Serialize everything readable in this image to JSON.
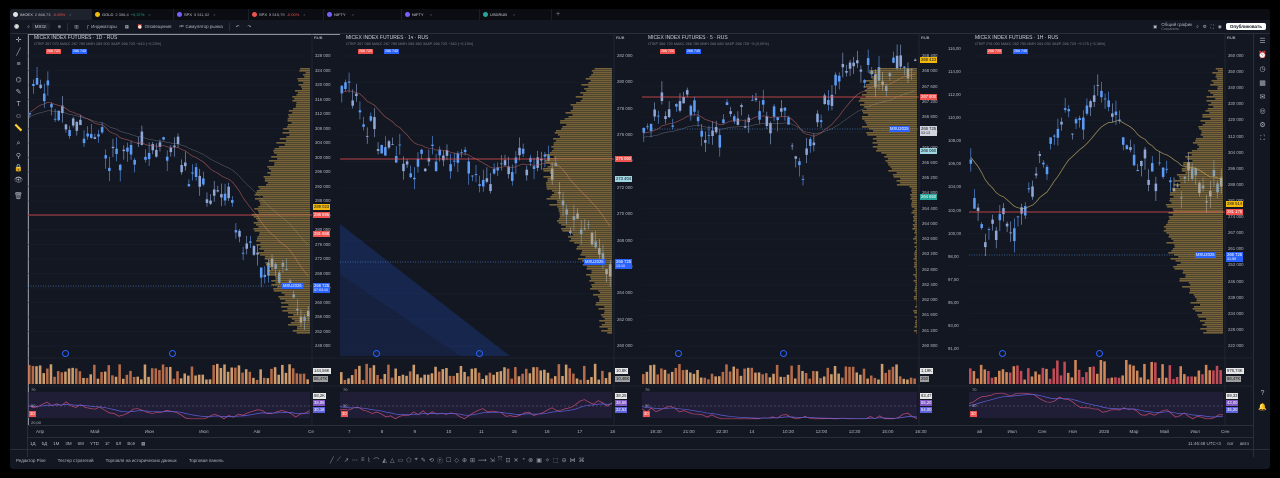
{
  "browser_tabs": [
    {
      "title": "IMOEX",
      "value": "2 868,73",
      "change": "-0,05%",
      "color": "#e2e2e2",
      "active": true
    },
    {
      "title": "GOLD",
      "value": "2 356,4",
      "change": "+0,37%",
      "color": "#f0b90b"
    },
    {
      "title": "SPX",
      "value": "5 511,02",
      "change": "",
      "color": "#7a5fff"
    },
    {
      "title": "SPX",
      "value": "5 515,79",
      "change": "-0,00%",
      "color": "#ef5350"
    },
    {
      "title": "NIFTY",
      "value": "",
      "change": "",
      "color": "#7a5fff"
    },
    {
      "title": "NIFTY",
      "value": "",
      "change": "",
      "color": "#7a5fff"
    },
    {
      "title": "USDRUB",
      "value": "",
      "change": "",
      "color": "#26a69a"
    }
  ],
  "toolbar": {
    "symbol": "MXI1!",
    "indicators": "Индикаторы",
    "alerts": "Оповещения",
    "simulator": "Симулятор рынка",
    "layout_name": "Общий график",
    "layout_sub": "Сохранить",
    "publish": "Опубликовать"
  },
  "left_tools": [
    "✛",
    "╱",
    "≡",
    "⌬",
    "✎",
    "T",
    "☺",
    "📏",
    "⌕",
    "⚲",
    "🔒",
    "👁",
    "🗑"
  ],
  "right_tools": [
    "☰",
    "⏰",
    "◷",
    "▦",
    "✉",
    "◎",
    "⚙",
    "⛶",
    "?",
    "🔔"
  ],
  "charts": [
    {
      "title": "MICEX INDEX FUTURES · 1D · RUS",
      "info": "ОТКР 267 070 МАКС 267 780 МИН 265 900 ЗАКР 266 725 −610 (−0,23%)",
      "badge_sell": "266 720",
      "badge_buy": "266 745",
      "currency": "RUB",
      "yticks": [
        "328 000",
        "324 000",
        "320 000",
        "316 000",
        "312 000",
        "308 000",
        "304 000",
        "300 000",
        "296 000",
        "292 000",
        "288 000",
        "284 000",
        "280 000",
        "276 000",
        "272 000",
        "268 000",
        "264 000",
        "260 000",
        "256 000",
        "252 000",
        "248 000"
      ],
      "price_tags": [
        {
          "label": "289 023",
          "bg": "#f0b90b",
          "fg": "#131722",
          "y": 173
        },
        {
          "label": "286 695",
          "bg": "#ef5350",
          "fg": "#ffffff",
          "y": 181
        },
        {
          "label": "281 668",
          "bg": "#ef5350",
          "fg": "#ffffff",
          "y": 200
        }
      ],
      "cur_label": "MXU2025",
      "cur_price": "266 725",
      "cur_time": "07:03:10",
      "vol_tags": [
        "144,56K",
        "86,47K"
      ],
      "osc_tags": [
        "58,2K",
        "38,95",
        "30,16"
      ],
      "osc_top": "70",
      "osc_mid": "50",
      "osc_low": "30",
      "osc_bottom": "20,00",
      "xlabels": [
        "Апр",
        "Май",
        "Июн",
        "Июл",
        "Авг",
        "Се"
      ]
    },
    {
      "title": "MICEX INDEX FUTURES · 1ч · RUS",
      "info": "ОТКР 267 065 МАКС 267 780 МИН 266 380 ЗАКР 266 725 −340 (−0,13%)",
      "badge_sell": "266 720",
      "badge_buy": "266 745",
      "currency": "RUB",
      "yticks": [
        "282 000",
        "280 000",
        "278 000",
        "276 000",
        "274 000",
        "272 000",
        "270 000",
        "268 000",
        "266 000",
        "264 000",
        "262 000",
        "260 000"
      ],
      "price_tags": [
        {
          "label": "275 060",
          "bg": "#ef5350",
          "fg": "#ffffff",
          "y": 125
        },
        {
          "label": "273 404",
          "bg": "#9fd8e3",
          "fg": "#131722",
          "y": 145
        }
      ],
      "cur_label": "MXU2025",
      "cur_price": "266 725",
      "cur_time": "13:10",
      "vol_tags": [
        "10,8K",
        "10,46K"
      ],
      "osc_tags": [
        "38,25",
        "35,56",
        "22,52"
      ],
      "osc_top": "70",
      "osc_mid": "50",
      "osc_low": "30",
      "osc_bottom": "",
      "xlabels": [
        "7",
        "8",
        "9",
        "10",
        "11",
        "15",
        "16",
        "17",
        "18"
      ]
    },
    {
      "title": "MICEX INDEX FUTURES · 5 · RUS",
      "info": "ОТКР 266 720 МАКС 266 780 МИН 266 680 ЗАКР 266 725 −5 (0,00%)",
      "badge_sell": "266 720",
      "badge_buy": "266 745",
      "currency": "RUB",
      "yticks": [
        "268 400",
        "268 000",
        "267 600",
        "267 200",
        "266 800",
        "266 400",
        "266 000",
        "265 600",
        "265 200",
        "264 800",
        "264 400",
        "264 000",
        "263 600",
        "263 200",
        "262 800",
        "262 400",
        "262 000",
        "261 600",
        "261 200",
        "260 800"
      ],
      "price_tags": [
        {
          "label": "268 423",
          "bg": "#f0b90b",
          "fg": "#131722",
          "y": 26
        },
        {
          "label": "267 800",
          "bg": "#ef5350",
          "fg": "#ffffff",
          "y": 63
        },
        {
          "label": "266 060",
          "bg": "#9fd8e3",
          "fg": "#131722",
          "y": 117
        },
        {
          "label": "264 650",
          "bg": "#26a69a",
          "fg": "#ffffff",
          "y": 163
        }
      ],
      "cur_label": "MXU2025",
      "cur_price": "266 725",
      "cur_time": "03:13",
      "vol_tags": [
        "1,19K",
        "250"
      ],
      "osc_tags": [
        "63,47",
        "55,20",
        "54,00"
      ],
      "osc_top": "70",
      "osc_mid": "50",
      "osc_low": "30",
      "osc_bottom": "",
      "xlabels": [
        "19:30",
        "21:00",
        "22:30",
        "14",
        "10:30",
        "12:00",
        "13:30",
        "15:00",
        "16:30"
      ]
    },
    {
      "title": "MICEX INDEX FUTURES · 1Н · RUS",
      "info": "ОТКР 276 000 МАКС 282 750 МИН 264 030 ЗАКР 266 725 −9 275 (−3,36%)",
      "badge_sell": "266 720",
      "badge_buy": "266 745",
      "currency": "RUB",
      "yticks": [
        "360 000",
        "350 000",
        "340 000",
        "330 000",
        "320 000",
        "312 000",
        "304 000",
        "296 000",
        "288 000",
        "281 000",
        "274 000",
        "267 000",
        "261 000",
        "253 000",
        "246 000",
        "239 000",
        "234 000",
        "228 000",
        "222 000"
      ],
      "left_yticks": [
        "116,00",
        "114,00",
        "112,00",
        "110,00",
        "108,00",
        "106,00",
        "104,00",
        "102,00",
        "100,00",
        "98,00",
        "97,50",
        "95,00",
        "93,00",
        "91,00"
      ],
      "price_tags": [
        {
          "label": "289 514",
          "bg": "#f0b90b",
          "fg": "#131722",
          "y": 170
        },
        {
          "label": "281 175",
          "bg": "#ef5350",
          "fg": "#ffffff",
          "y": 178
        }
      ],
      "cur_label": "MXU2025",
      "cur_price": "266 725",
      "cur_time": "31:59",
      "vol_tags": [
        "976,74K",
        "86,47K"
      ],
      "osc_tags": [
        "69,33",
        "43,00",
        "35,20"
      ],
      "osc_top": "70",
      "osc_mid": "50",
      "osc_low": "30",
      "osc_bottom": "",
      "xlabels": [
        "ай",
        "Июл",
        "Сен",
        "Ноя",
        "2025",
        "Мар",
        "Май",
        "Июл",
        "Сен"
      ]
    }
  ],
  "timebar": {
    "ranges": [
      "1Д",
      "5Д",
      "1М",
      "3М",
      "6М",
      "YTD",
      "1Г",
      "5Л",
      "Всё"
    ],
    "time": "11:46:48 UTC+3",
    "mode1": "лог",
    "mode2": "авто"
  },
  "bottom": {
    "pine": "Редактор Pine",
    "tester": "Тестер стратегий",
    "trading": "Торговля на исторических данных",
    "panel": "Торговая панель"
  }
}
